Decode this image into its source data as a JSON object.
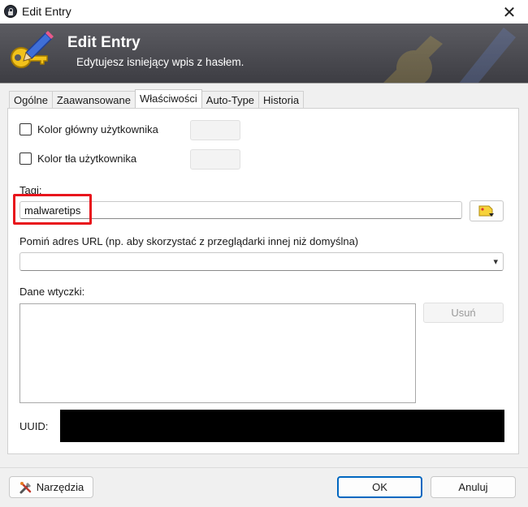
{
  "window": {
    "title": "Edit Entry",
    "close_glyph": "✕"
  },
  "banner": {
    "title": "Edit Entry",
    "subtitle": "Edytujesz isniejący wpis z hasłem."
  },
  "tabs": [
    {
      "label": "Ogólne",
      "active": false
    },
    {
      "label": "Zaawansowane",
      "active": false
    },
    {
      "label": "Właściwości",
      "active": true
    },
    {
      "label": "Auto-Type",
      "active": false
    },
    {
      "label": "Historia",
      "active": false
    }
  ],
  "properties": {
    "fg_color_label": "Kolor główny użytkownika",
    "bg_color_label": "Kolor tła użytkownika",
    "tags_label": "Tagi:",
    "tags_value": "malwaretips",
    "url_override_label": "Pomiń adres URL (np. aby skorzystać z przeglądarki innej niż domyślna)",
    "url_override_value": "",
    "plugin_data_label": "Dane wtyczki:",
    "delete_label": "Usuń",
    "uuid_label": "UUID:"
  },
  "footer": {
    "tools_label": "Narzędzia",
    "ok_label": "OK",
    "cancel_label": "Anuluj"
  },
  "colors": {
    "banner": "#4a4a50",
    "highlight": "#e8141c",
    "primary_border": "#0067c0"
  }
}
